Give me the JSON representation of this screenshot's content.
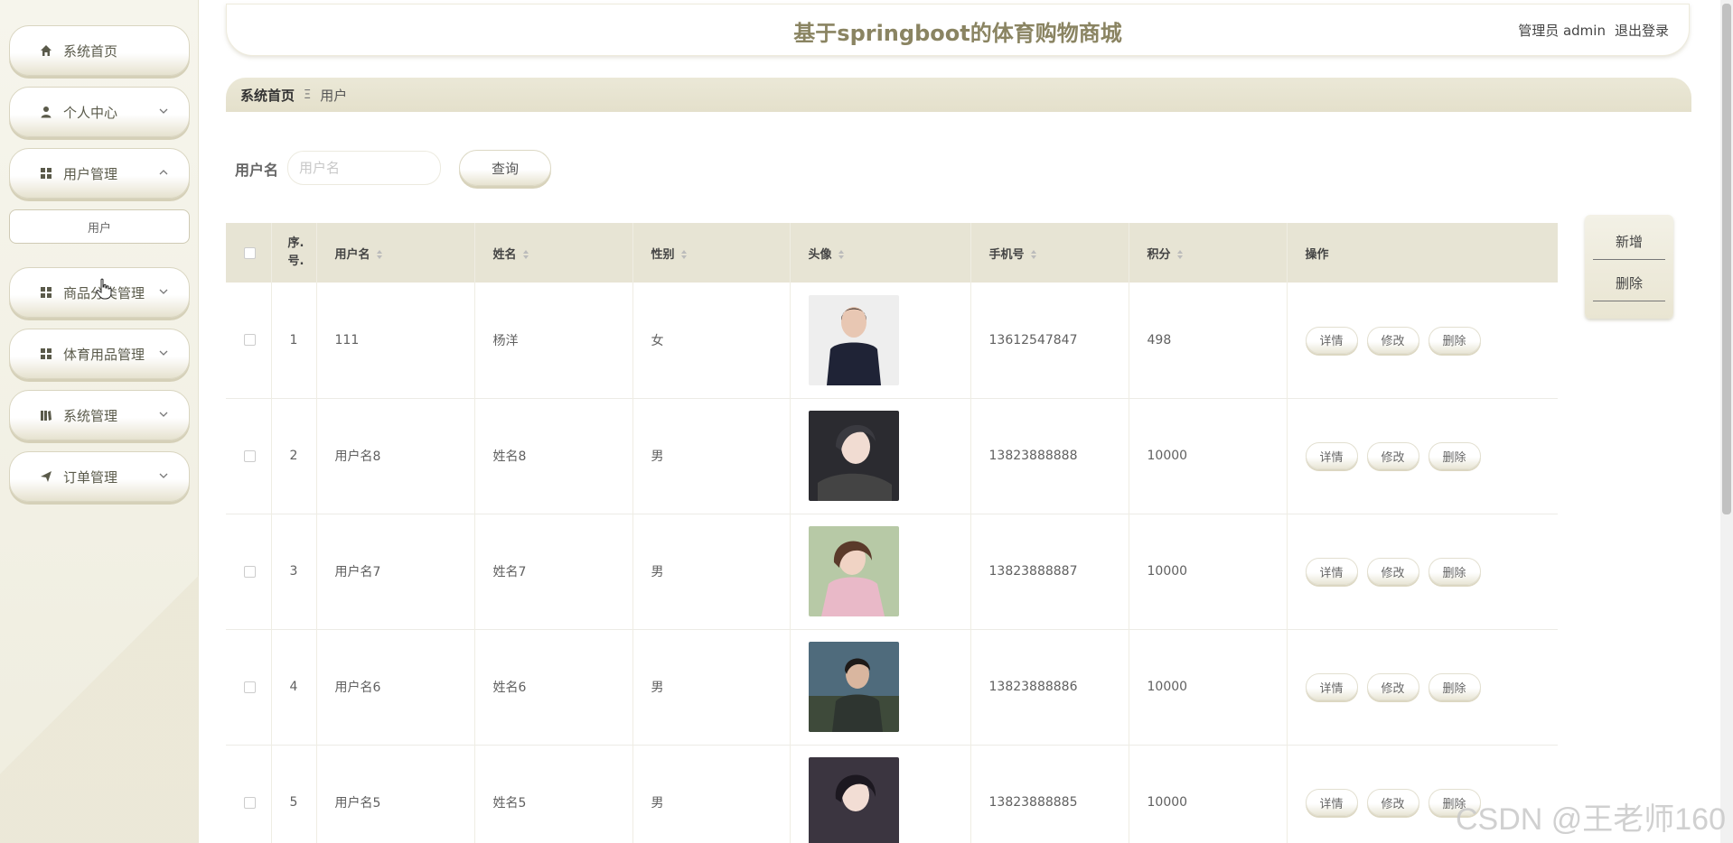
{
  "app": {
    "title": "基于springboot的体育购物商城",
    "role_user": "管理员 admin",
    "logout": "退出登录"
  },
  "sidebar": {
    "items": [
      {
        "label": "系统首页",
        "icon": "home-icon"
      },
      {
        "label": "个人中心",
        "icon": "person-icon"
      },
      {
        "label": "用户管理",
        "icon": "grid-icon"
      },
      {
        "label": "商品分类管理",
        "icon": "grid-icon"
      },
      {
        "label": "体育用品管理",
        "icon": "grid-icon"
      },
      {
        "label": "系统管理",
        "icon": "book-icon"
      },
      {
        "label": "订单管理",
        "icon": "send-icon"
      }
    ],
    "submenu": {
      "label": "用户"
    }
  },
  "breadcrumb": {
    "home": "系统首页",
    "separator": "Ξ",
    "current": "用户"
  },
  "search": {
    "label": "用户名",
    "placeholder": "用户名",
    "value": "",
    "button": "查询"
  },
  "actions": {
    "add": "新增",
    "delete": "删除"
  },
  "table": {
    "columns": [
      "序.号.",
      "用户名",
      "姓名",
      "性别",
      "头像",
      "手机号",
      "积分",
      "操作"
    ],
    "rows": [
      {
        "no": "1",
        "username": "111",
        "name": "杨洋",
        "gender": "女",
        "phone": "13612547847",
        "points": "498"
      },
      {
        "no": "2",
        "username": "用户名8",
        "name": "姓名8",
        "gender": "男",
        "phone": "13823888888",
        "points": "10000"
      },
      {
        "no": "3",
        "username": "用户名7",
        "name": "姓名7",
        "gender": "男",
        "phone": "13823888887",
        "points": "10000"
      },
      {
        "no": "4",
        "username": "用户名6",
        "name": "姓名6",
        "gender": "男",
        "phone": "13823888886",
        "points": "10000"
      },
      {
        "no": "5",
        "username": "用户名5",
        "name": "姓名5",
        "gender": "男",
        "phone": "13823888885",
        "points": "10000"
      }
    ],
    "row_actions": {
      "detail": "详情",
      "edit": "修改",
      "delete": "删除"
    }
  },
  "watermark": "CSDN @王老师160",
  "colors": {
    "accent": "#8a8462",
    "header_bg": "#e7e4d4",
    "sidebar_bg": "#f3f1e6"
  }
}
